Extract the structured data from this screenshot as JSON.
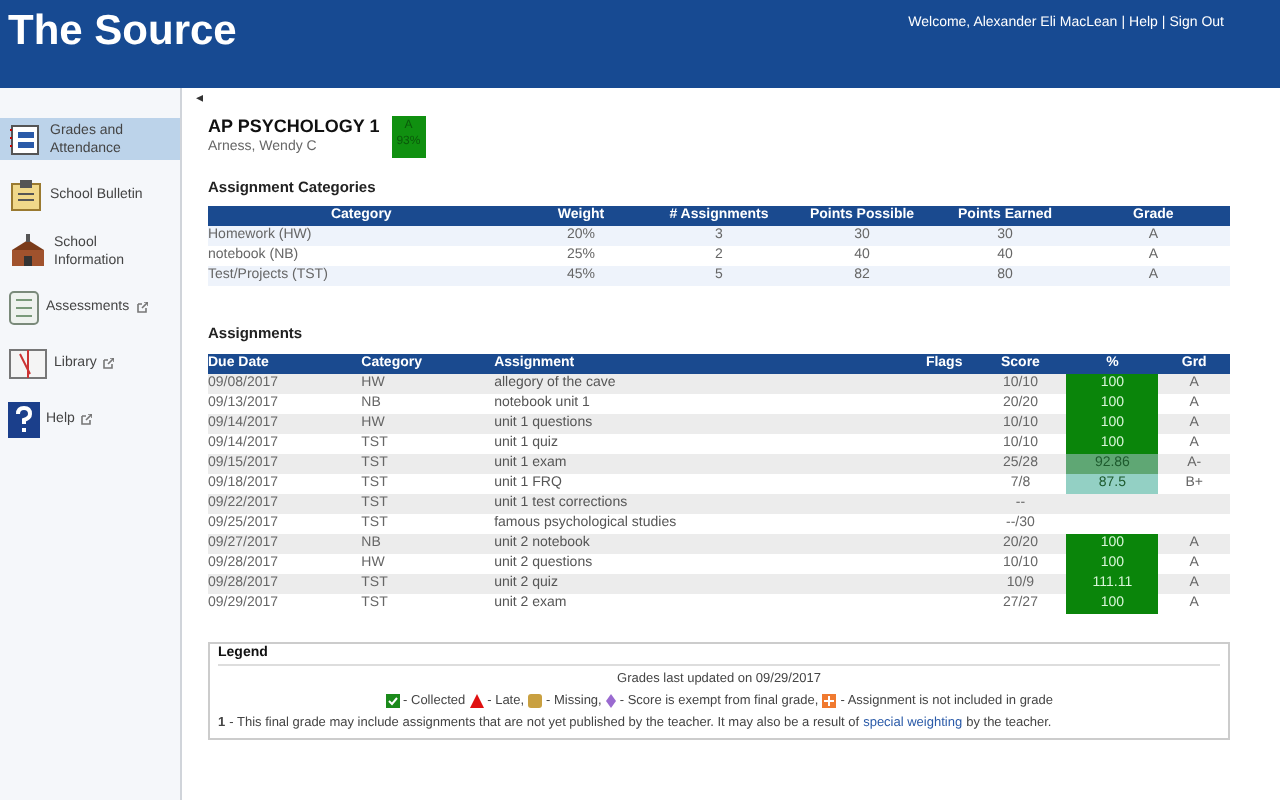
{
  "header": {
    "title": "The Source",
    "welcome": "Welcome, Alexander Eli MacLean",
    "separator": "|",
    "links": [
      "Help",
      "Sign Out"
    ]
  },
  "sidebar": {
    "items": [
      {
        "label": "Grades and Attendance",
        "kind": "grades",
        "external": false,
        "selected": true
      },
      {
        "label": "School Bulletin",
        "kind": "bulletin",
        "external": false,
        "selected": false
      },
      {
        "label": "School Information",
        "kind": "school",
        "external": false,
        "selected": false
      },
      {
        "label": "Assessments",
        "kind": "assessments",
        "external": true,
        "selected": false
      },
      {
        "label": "Library",
        "kind": "library",
        "external": true,
        "selected": false
      },
      {
        "label": "Help",
        "kind": "help",
        "external": true,
        "selected": false
      }
    ]
  },
  "collapse_arrow": "◂",
  "course": {
    "title": "AP PSYCHOLOGY 1",
    "teacher": "Arness, Wendy C",
    "grade": "A",
    "percent": "93%"
  },
  "categories": {
    "title": "Assignment Categories",
    "columns": [
      "Category",
      "Weight",
      "# Assignments",
      "Points Possible",
      "Points Earned",
      "Grade"
    ],
    "rows": [
      [
        "Homework (HW)",
        "20%",
        "3",
        "30",
        "30",
        "A"
      ],
      [
        "notebook (NB)",
        "25%",
        "2",
        "40",
        "40",
        "A"
      ],
      [
        "Test/Projects (TST)",
        "45%",
        "5",
        "82",
        "80",
        "A"
      ]
    ]
  },
  "assignments": {
    "title": "Assignments",
    "columns": [
      "Due Date",
      "Category",
      "Assignment",
      "Flags",
      "Score",
      "%",
      "Grd"
    ],
    "rows": [
      {
        "due": "09/08/2017",
        "category": "HW",
        "name": "allegory of the cave",
        "score": "10/10",
        "percent": "100",
        "color": "#0a850a",
        "grade": "A"
      },
      {
        "due": "09/13/2017",
        "category": "NB",
        "name": "notebook unit 1",
        "score": "20/20",
        "percent": "100",
        "color": "#0a850a",
        "grade": "A"
      },
      {
        "due": "09/14/2017",
        "category": "HW",
        "name": "unit 1 questions",
        "score": "10/10",
        "percent": "100",
        "color": "#0a850a",
        "grade": "A"
      },
      {
        "due": "09/14/2017",
        "category": "TST",
        "name": "unit 1 quiz",
        "score": "10/10",
        "percent": "100",
        "color": "#0a850a",
        "grade": "A"
      },
      {
        "due": "09/15/2017",
        "category": "TST",
        "name": "unit 1 exam",
        "score": "25/28",
        "percent": "92.86",
        "color": "#5fa774",
        "grade": "A-"
      },
      {
        "due": "09/18/2017",
        "category": "TST",
        "name": "unit 1 FRQ",
        "score": "7/8",
        "percent": "87.5",
        "color": "#93d0c4",
        "grade": "B+"
      },
      {
        "due": "09/22/2017",
        "category": "TST",
        "name": "unit 1 test corrections",
        "score": "--"
      },
      {
        "due": "09/25/2017",
        "category": "TST",
        "name": "famous psychological studies",
        "score": "--/30"
      },
      {
        "due": "09/27/2017",
        "category": "NB",
        "name": "unit 2 notebook",
        "score": "20/20",
        "percent": "100",
        "color": "#0a850a",
        "grade": "A"
      },
      {
        "due": "09/28/2017",
        "category": "HW",
        "name": "unit 2 questions",
        "score": "10/10",
        "percent": "100",
        "color": "#0a850a",
        "grade": "A"
      },
      {
        "due": "09/28/2017",
        "category": "TST",
        "name": "unit 2 quiz",
        "score": "10/9",
        "percent": "111.11",
        "color": "#0a850a",
        "grade": "A"
      },
      {
        "due": "09/29/2017",
        "category": "TST",
        "name": "unit 2 exam",
        "score": "27/27",
        "percent": "100",
        "color": "#0a850a",
        "grade": "A"
      }
    ]
  },
  "legend": {
    "title": "Legend",
    "updated": "Grades last updated on 09/29/2017",
    "items": [
      {
        "kind": "collected",
        "label": "- Collected"
      },
      {
        "kind": "late",
        "label": "- Late,"
      },
      {
        "kind": "missing",
        "label": "- Missing,"
      },
      {
        "kind": "exempt",
        "label": "- Score is exempt from final grade,"
      },
      {
        "kind": "excluded",
        "label": "- Assignment is not included in grade"
      }
    ],
    "footnote_mark": "1",
    "footnote": "- This final grade may include assignments that are not yet published by the teacher. It may also be a result of",
    "footnote_link": "special weighting",
    "footnote_end": "by the teacher."
  }
}
